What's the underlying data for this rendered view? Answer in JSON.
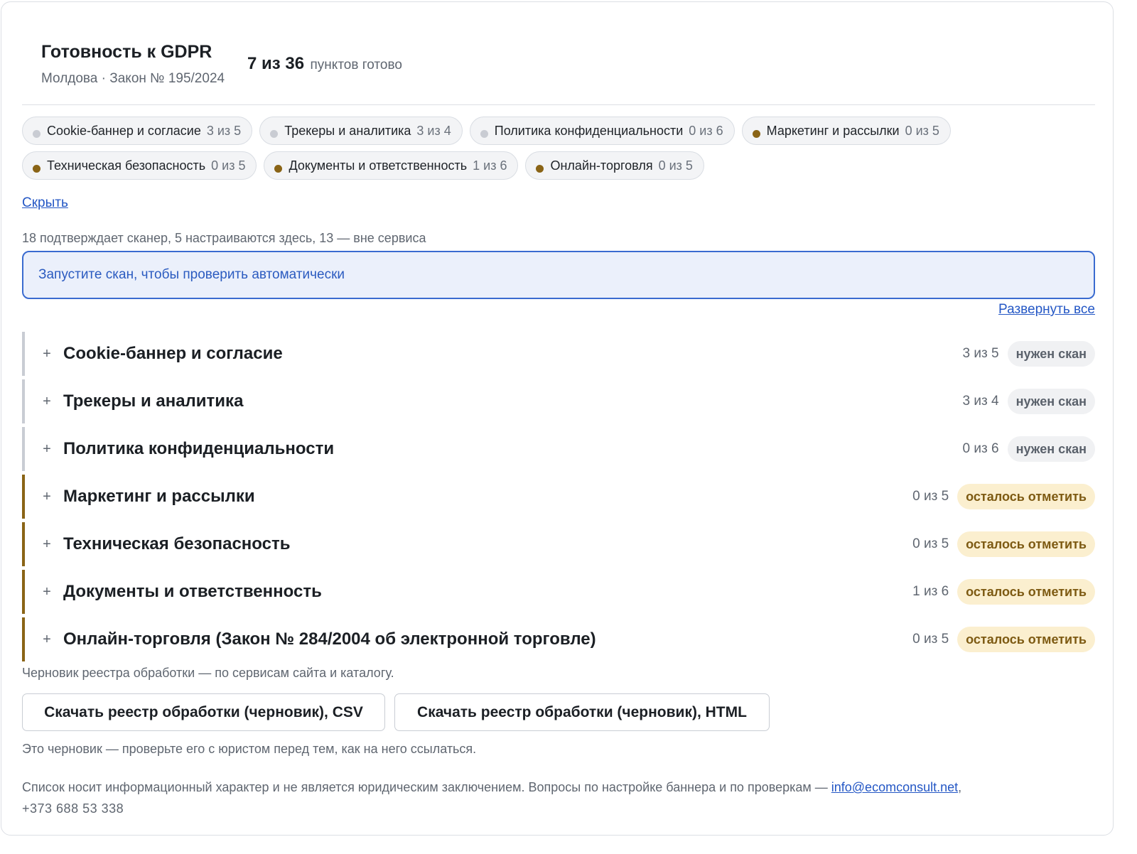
{
  "header": {
    "title": "Готовность к GDPR",
    "subtitle": "Молдова · Закон № 195/2024",
    "progress_main": "7 из 36",
    "progress_suffix": "пунктов готово"
  },
  "colors": {
    "accent_blue": "#2457c5",
    "status_scan_dot": "#c9ccd3",
    "status_todo_dot": "#8a6416",
    "badge_mark_bg": "#fbefcf"
  },
  "chips": [
    {
      "label": "Cookie-баннер и согласие",
      "count": "3 из 5",
      "status": "scan"
    },
    {
      "label": "Трекеры и аналитика",
      "count": "3 из 4",
      "status": "scan"
    },
    {
      "label": "Политика конфиденциальности",
      "count": "0 из 6",
      "status": "scan"
    },
    {
      "label": "Маркетинг и рассылки",
      "count": "0 из 5",
      "status": "todo"
    },
    {
      "label": "Техническая безопасность",
      "count": "0 из 5",
      "status": "todo"
    },
    {
      "label": "Документы и ответственность",
      "count": "1 из 6",
      "status": "todo"
    },
    {
      "label": "Онлайн-торговля",
      "count": "0 из 5",
      "status": "todo"
    }
  ],
  "hide_link": "Скрыть",
  "summary": "18 подтверждает сканер, 5 настраиваются здесь, 13 — вне сервиса",
  "scan_prompt": "Запустите скан, чтобы проверить автоматически",
  "expand_all": "Развернуть все",
  "sections": [
    {
      "plus": "+",
      "name": "Cookie-баннер и согласие",
      "count": "3 из 5",
      "badge": "нужен скан",
      "status": "scan"
    },
    {
      "plus": "+",
      "name": "Трекеры и аналитика",
      "count": "3 из 4",
      "badge": "нужен скан",
      "status": "scan"
    },
    {
      "plus": "+",
      "name": "Политика конфиденциальности",
      "count": "0 из 6",
      "badge": "нужен скан",
      "status": "scan"
    },
    {
      "plus": "+",
      "name": "Маркетинг и рассылки",
      "count": "0 из 5",
      "badge": "осталось отметить",
      "status": "todo"
    },
    {
      "plus": "+",
      "name": "Техническая безопасность",
      "count": "0 из 5",
      "badge": "осталось отметить",
      "status": "todo"
    },
    {
      "plus": "+",
      "name": "Документы и ответственность",
      "count": "1 из 6",
      "badge": "осталось отметить",
      "status": "todo"
    },
    {
      "plus": "+",
      "name": "Онлайн-торговля (Закон № 284/2004 об электронной торговле)",
      "count": "0 из 5",
      "badge": "осталось отметить",
      "status": "todo"
    }
  ],
  "draft_note": "Черновик реестра обработки — по сервисам сайта и каталогу.",
  "buttons": {
    "csv": "Скачать реестр обработки (черновик), CSV",
    "html": "Скачать реестр обработки (черновик), HTML"
  },
  "warning": "Это черновик — проверьте его с юристом перед тем, как на него ссылаться.",
  "footer": {
    "text": "Список носит информационный характер и не является юридическим заключением. Вопросы по настройке баннера и по проверкам — ",
    "email": "info@ecomconsult.net",
    "separator": ",",
    "phone": "+373 688 53 338"
  }
}
